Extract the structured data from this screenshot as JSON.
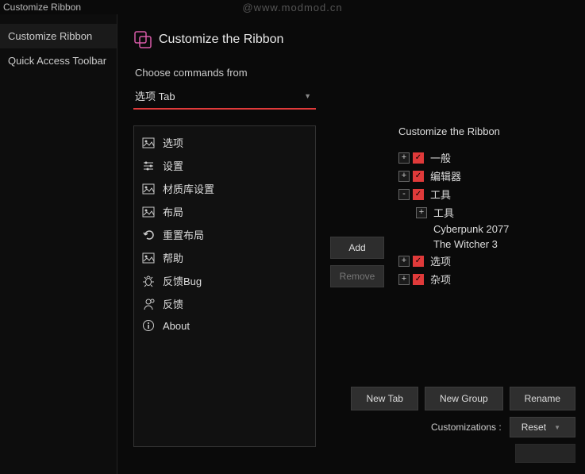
{
  "titlebar": {
    "title": "Customize Ribbon"
  },
  "watermark": "@www.modmod.cn",
  "sidebar": {
    "items": [
      {
        "label": "Customize Ribbon",
        "active": true
      },
      {
        "label": "Quick Access Toolbar",
        "active": false
      }
    ]
  },
  "header": {
    "title": "Customize the Ribbon"
  },
  "choose_label": "Choose commands from",
  "dropdown": {
    "value": "选项 Tab"
  },
  "commands": [
    {
      "icon": "image",
      "label": "选项"
    },
    {
      "icon": "sliders",
      "label": "设置"
    },
    {
      "icon": "image",
      "label": "材质库设置"
    },
    {
      "icon": "image",
      "label": "布局"
    },
    {
      "icon": "undo",
      "label": "重置布局"
    },
    {
      "icon": "image",
      "label": "帮助"
    },
    {
      "icon": "bug",
      "label": "反馈Bug"
    },
    {
      "icon": "person",
      "label": "反馈"
    },
    {
      "icon": "info",
      "label": "About"
    }
  ],
  "mid": {
    "add": "Add",
    "remove": "Remove"
  },
  "right": {
    "title": "Customize the Ribbon",
    "tree": [
      {
        "expand": "+",
        "checked": true,
        "label": "一般",
        "indent": 0
      },
      {
        "expand": "+",
        "checked": true,
        "label": "编辑器",
        "indent": 0
      },
      {
        "expand": "-",
        "checked": true,
        "label": "工具",
        "indent": 0
      },
      {
        "expand": "+",
        "checked": null,
        "label": "工具",
        "indent": 1
      },
      {
        "expand": null,
        "checked": null,
        "label": "Cyberpunk 2077",
        "indent": 2
      },
      {
        "expand": null,
        "checked": null,
        "label": "The Witcher 3",
        "indent": 2
      },
      {
        "expand": "+",
        "checked": true,
        "label": "选项",
        "indent": 0
      },
      {
        "expand": "+",
        "checked": true,
        "label": "杂项",
        "indent": 0
      }
    ]
  },
  "bottom": {
    "new_tab": "New Tab",
    "new_group": "New Group",
    "rename": "Rename",
    "cust_label": "Customizations :",
    "reset": "Reset"
  }
}
